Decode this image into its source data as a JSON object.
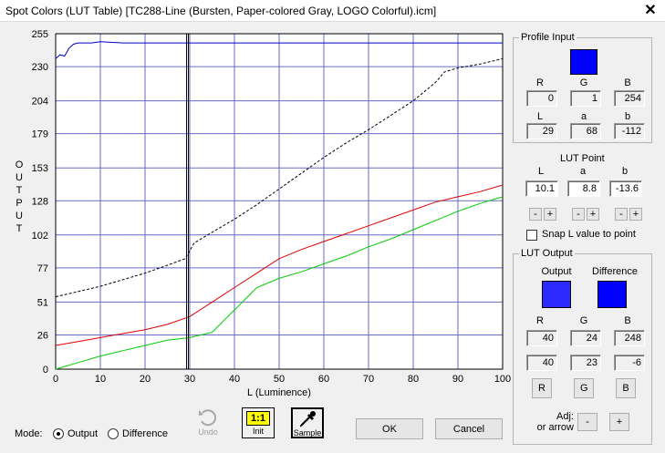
{
  "window": {
    "title": "Spot Colors (LUT Table) [TC288-Line (Bursten, Paper-colored Gray, LOGO Colorful).icm]",
    "close_glyph": "✕"
  },
  "chart_data": {
    "type": "line",
    "xlabel": "L (Luminence)",
    "ylabel": "OUTPUT",
    "xlim": [
      0,
      100
    ],
    "ylim": [
      0,
      255
    ],
    "x_ticks": [
      0,
      10,
      20,
      30,
      40,
      50,
      60,
      70,
      80,
      90,
      100
    ],
    "y_ticks": [
      0,
      26,
      51,
      77,
      102,
      128,
      153,
      179,
      204,
      230,
      255
    ],
    "grid": true,
    "cursor_x": 29.5,
    "series": [
      {
        "color": "#0000cc",
        "style": "solid",
        "x": [
          0,
          1,
          2,
          3,
          4,
          5,
          6,
          8,
          10,
          15,
          20,
          25,
          30,
          35,
          40,
          45,
          50,
          55,
          60,
          65,
          70,
          75,
          80,
          85,
          90,
          95,
          100
        ],
        "y": [
          236,
          239,
          238,
          244,
          247,
          248,
          248,
          248,
          249,
          248,
          248,
          248,
          248,
          248,
          248,
          248,
          248,
          248,
          248,
          248,
          248,
          248,
          248,
          248,
          248,
          248,
          248
        ]
      },
      {
        "color": "#000000",
        "style": "dashed",
        "x": [
          0,
          5,
          10,
          15,
          20,
          25,
          29,
          30,
          31,
          35,
          40,
          45,
          50,
          55,
          60,
          65,
          70,
          75,
          80,
          85,
          87,
          90,
          95,
          100
        ],
        "y": [
          55,
          59,
          63,
          68,
          73,
          79,
          84,
          90,
          96,
          104,
          114,
          125,
          137,
          149,
          161,
          172,
          182,
          193,
          204,
          218,
          226,
          229,
          232,
          236
        ]
      },
      {
        "color": "#e00000",
        "style": "solid",
        "x": [
          0,
          5,
          10,
          15,
          20,
          25,
          30,
          35,
          40,
          45,
          50,
          55,
          60,
          65,
          70,
          75,
          80,
          85,
          90,
          95,
          100
        ],
        "y": [
          18,
          21,
          24,
          27,
          30,
          34,
          40,
          51,
          62,
          73,
          84,
          91,
          97,
          103,
          109,
          115,
          121,
          127,
          131,
          135,
          140
        ]
      },
      {
        "color": "#00cc00",
        "style": "solid",
        "x": [
          0,
          5,
          10,
          15,
          20,
          25,
          30,
          35,
          40,
          45,
          50,
          55,
          60,
          65,
          70,
          75,
          80,
          85,
          90,
          95,
          100
        ],
        "y": [
          0,
          5,
          10,
          14,
          18,
          22,
          24,
          28,
          45,
          62,
          69,
          74,
          80,
          86,
          93,
          99,
          106,
          113,
          120,
          126,
          131
        ]
      }
    ]
  },
  "profile_input": {
    "title": "Profile Input",
    "swatch_color": "#0000ff",
    "R_label": "R",
    "G_label": "G",
    "B_label": "B",
    "R": "0",
    "G": "1",
    "B": "254",
    "L_label": "L",
    "a_label": "a",
    "b_label": "b",
    "L": "29",
    "a": "68",
    "b": "-112"
  },
  "lut_point": {
    "title": "LUT Point",
    "L_label": "L",
    "a_label": "a",
    "b_label": "b",
    "L": "10.1",
    "a": "8.8",
    "b": "-13.6",
    "minus": "-",
    "plus": "+",
    "snap_label": "Snap L value to point",
    "snap_checked": false
  },
  "lut_output": {
    "title": "LUT Output",
    "output_label": "Output",
    "difference_label": "Difference",
    "output_color": "#2a2aff",
    "difference_color": "#0000ff",
    "R_label": "R",
    "G_label": "G",
    "B_label": "B",
    "R": "40",
    "G": "24",
    "B": "248",
    "dR": "40",
    "dG": "23",
    "dB": "-6",
    "btn_R": "R",
    "btn_G": "G",
    "btn_B": "B",
    "adj_label": "Adj:",
    "adj_label2": "or arrow",
    "adj_minus": "-",
    "adj_plus": "+"
  },
  "mode": {
    "label": "Mode:",
    "output_label": "Output",
    "difference_label": "Difference",
    "selected": "output"
  },
  "tools": {
    "undo_label": "Undo",
    "init_label": "Init",
    "init_badge": "1:1",
    "sample_label": "Sample"
  },
  "buttons": {
    "ok": "OK",
    "cancel": "Cancel"
  }
}
